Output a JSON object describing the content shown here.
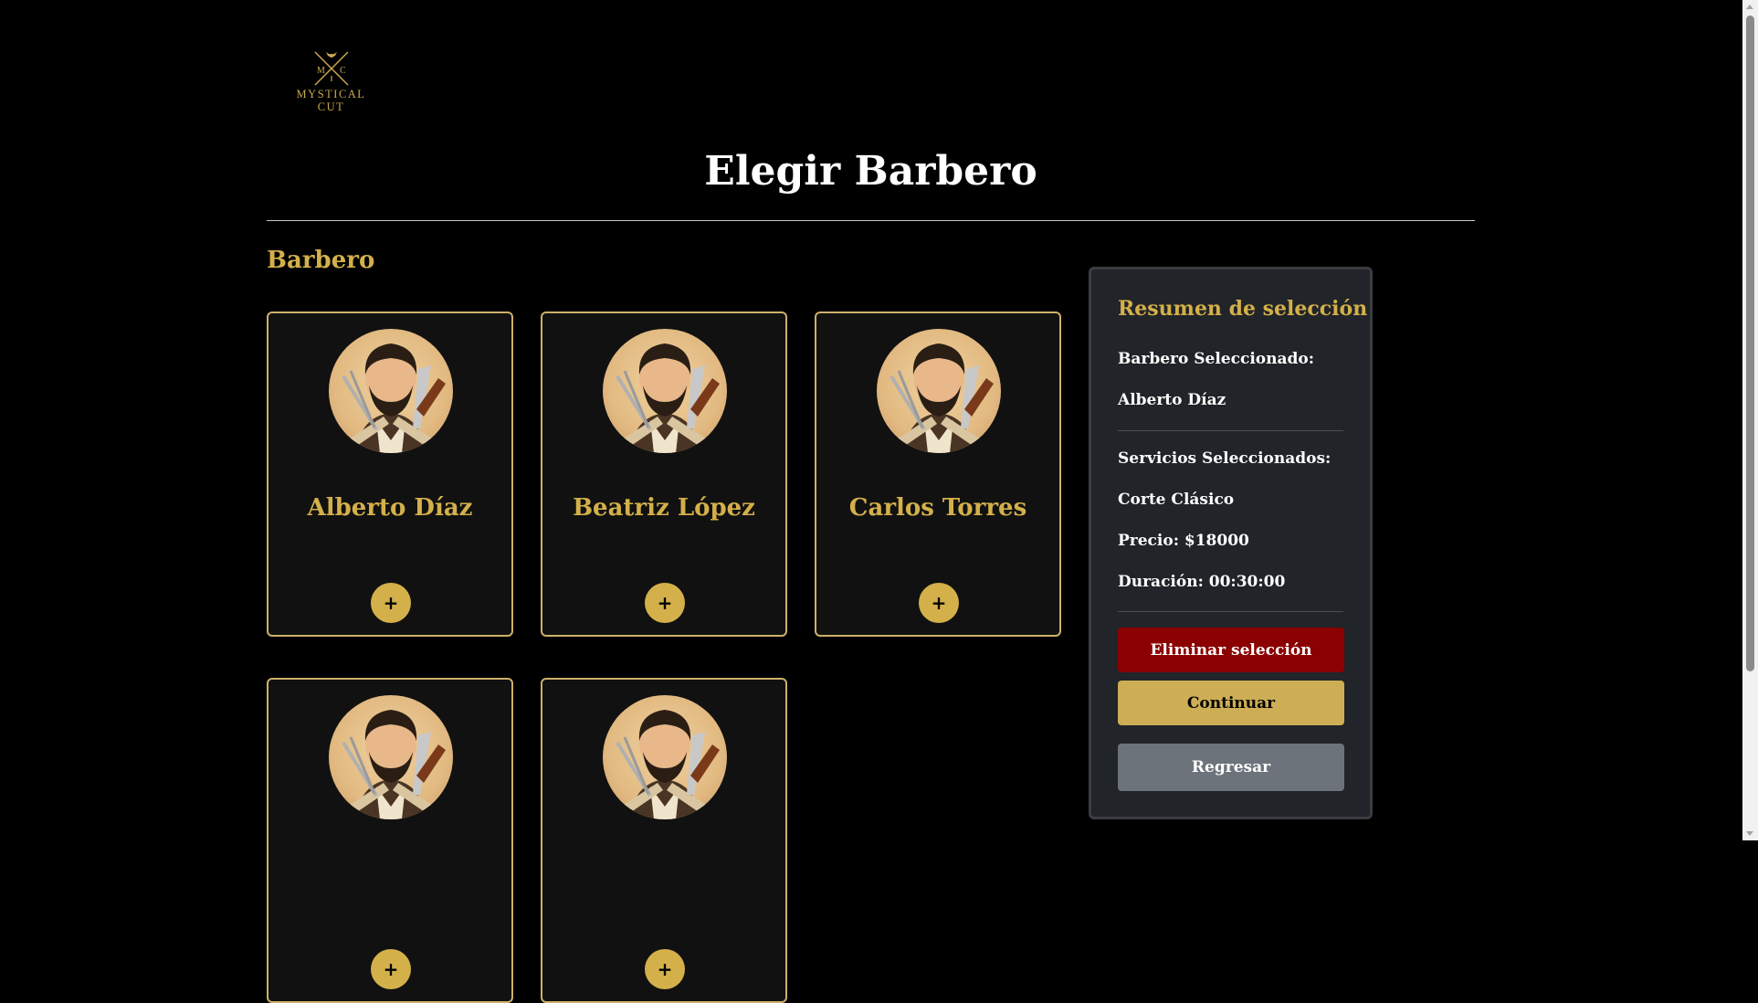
{
  "brand": {
    "monogram_left": "M",
    "monogram_right": "C",
    "line1": "MYSTICAL",
    "line2": "CUT",
    "color": "#c9a94e"
  },
  "page": {
    "title": "Elegir Barbero",
    "section_title": "Barbero"
  },
  "barbers": [
    {
      "name": "Alberto Díaz",
      "add_label": "+"
    },
    {
      "name": "Beatriz López",
      "add_label": "+"
    },
    {
      "name": "Carlos Torres",
      "add_label": "+"
    },
    {
      "name": "",
      "add_label": "+"
    },
    {
      "name": "",
      "add_label": "+"
    }
  ],
  "summary": {
    "title": "Resumen de selección",
    "barber_label": "Barbero Seleccionado:",
    "barber_value": "Alberto Díaz",
    "services_label": "Servicios Seleccionados:",
    "service_name": "Corte Clásico",
    "price": "Precio: $18000",
    "duration": "Duración: 00:30:00",
    "delete_label": "Eliminar selección",
    "continue_label": "Continuar",
    "back_label": "Regresar"
  },
  "colors": {
    "accent_gold": "#d4b04a",
    "danger": "#8b0000",
    "secondary": "#6c737b",
    "panel": "#212428"
  }
}
